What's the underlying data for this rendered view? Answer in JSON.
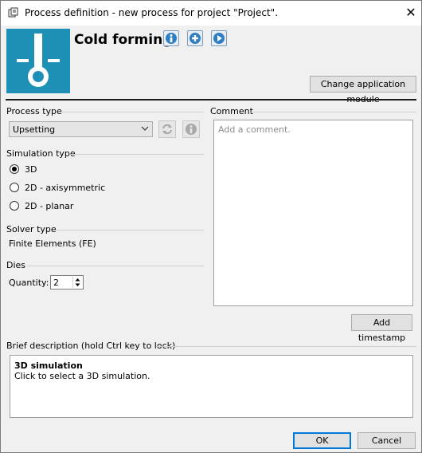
{
  "window": {
    "title": "Process definition - new process for project \"Project\".",
    "close_glyph": "✕",
    "app_icon": "dialog-icon"
  },
  "header": {
    "module_title": "Cold forming",
    "module_icon": "thermometer-icon",
    "icon_color": "#1e8fb5",
    "buttons": [
      "info-icon",
      "add-icon",
      "play-icon"
    ],
    "change_module_label": "Change application module"
  },
  "process_type": {
    "label": "Process type",
    "selected": "Upsetting",
    "chevron": "⌵"
  },
  "simulation_type": {
    "label": "Simulation type",
    "options": [
      {
        "label": "3D",
        "checked": true
      },
      {
        "label": "2D - axisymmetric",
        "checked": false
      },
      {
        "label": "2D - planar",
        "checked": false
      }
    ]
  },
  "solver_type": {
    "label": "Solver type",
    "value": "Finite Elements (FE)"
  },
  "dies": {
    "label": "Dies",
    "quantity_label": "Quantity:",
    "quantity": "2"
  },
  "comment": {
    "label": "Comment",
    "placeholder": "Add a comment.",
    "add_timestamp_label": "Add timestamp"
  },
  "brief_description": {
    "label": "Brief description (hold Ctrl key to lock)",
    "title": "3D simulation",
    "text": "Click to select a 3D simulation."
  },
  "footer": {
    "ok_label": "OK",
    "cancel_label": "Cancel"
  }
}
